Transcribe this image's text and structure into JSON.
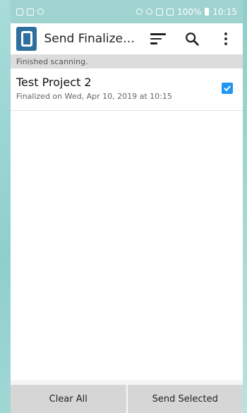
{
  "status_bar": {
    "battery": "100%",
    "time": "10:15"
  },
  "app_bar": {
    "title": "Send Finalized F...",
    "icons": [
      "sort-icon",
      "search-icon",
      "more-vert-icon"
    ]
  },
  "banner": {
    "text": "Finished scanning."
  },
  "list": {
    "items": [
      {
        "title": "Test Project 2",
        "subtitle": "Finalized on Wed, Apr 10, 2019 at 10:15",
        "checked": true
      }
    ]
  },
  "footer": {
    "clear_label": "Clear All",
    "send_label": "Send Selected"
  },
  "colors": {
    "accent": "#2196f3",
    "logo": "#2f6f9e",
    "status_bar": "#9fd3d0"
  }
}
